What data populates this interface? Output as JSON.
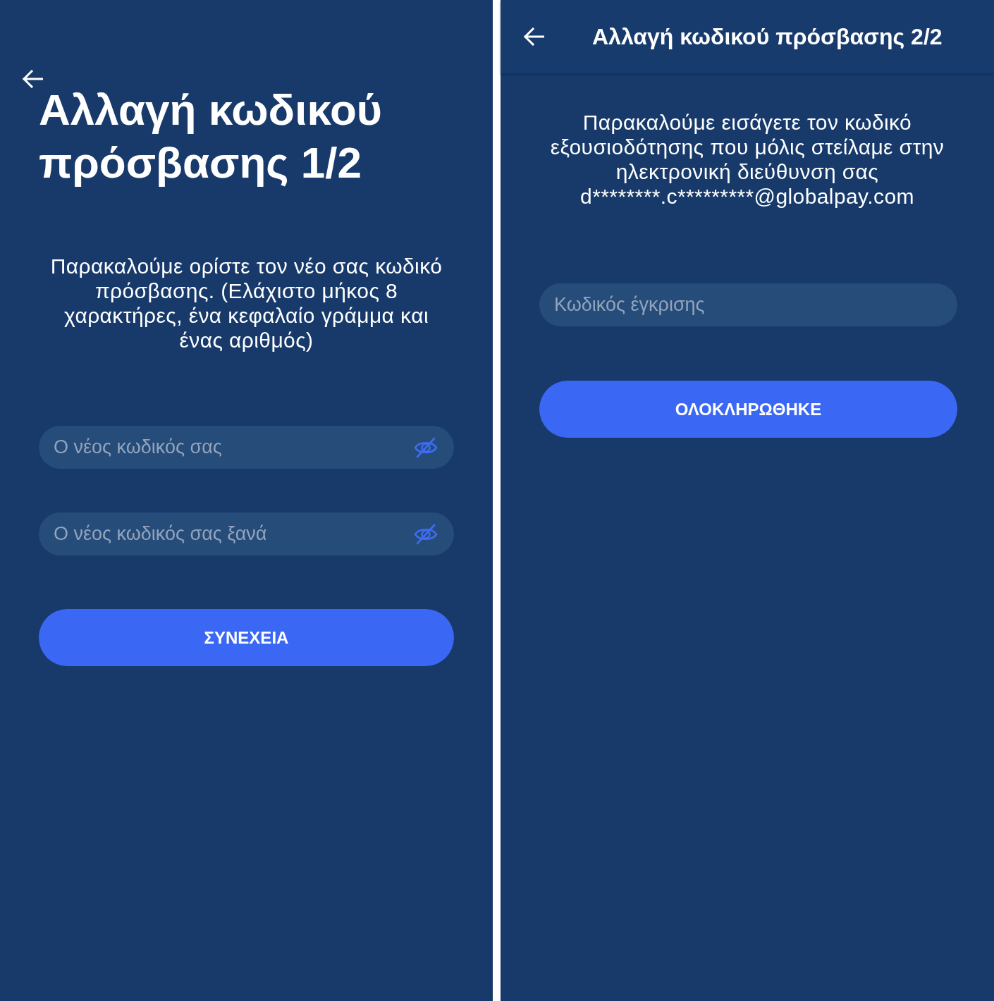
{
  "screens": [
    {
      "kind": "large_title",
      "title": "Αλλαγή κωδικού πρόσβασης 1/2",
      "instructions": "Παρακαλούμε ορίστε τον νέο σας κωδικό πρόσβασης. (Ελάχιστο μήκος 8 χαρακτήρες, ένα κεφαλαίο γράμμα και ένας αριθμός)",
      "fields": [
        {
          "kind": "password",
          "placeholder": "Ο νέος κωδικός σας"
        },
        {
          "kind": "password",
          "placeholder": "Ο νέος κωδικός σας ξανά"
        }
      ],
      "button": "ΣΥΝΕΧΕΙΑ"
    },
    {
      "kind": "app_bar",
      "title": "Αλλαγή κωδικού πρόσβασης 2/2",
      "instructions": "Παρακαλούμε εισάγετε τον κωδικό εξουσιοδότησης που μόλις στείλαμε στην ηλεκτρονική διεύθυνση σας d********.c*********@globalpay.com",
      "fields": [
        {
          "kind": "code",
          "placeholder": "Κωδικός έγκρισης"
        }
      ],
      "button": "ΟΛΟΚΛΗΡΩΘΗΚΕ"
    }
  ]
}
